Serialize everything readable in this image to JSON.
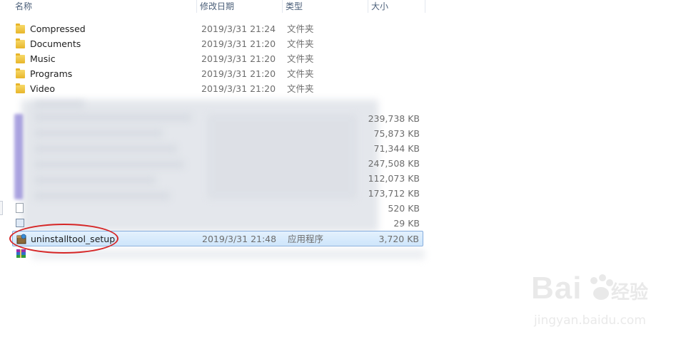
{
  "columns": {
    "name": "名称",
    "date": "修改日期",
    "type": "类型",
    "size": "大小"
  },
  "folders": [
    {
      "name": "Compressed",
      "date": "2019/3/31 21:24",
      "type": "文件夹"
    },
    {
      "name": "Documents",
      "date": "2019/3/31 21:20",
      "type": "文件夹"
    },
    {
      "name": "Music",
      "date": "2019/3/31 21:20",
      "type": "文件夹"
    },
    {
      "name": "Programs",
      "date": "2019/3/31 21:20",
      "type": "文件夹"
    },
    {
      "name": "Video",
      "date": "2019/3/31 21:20",
      "type": "文件夹"
    }
  ],
  "blurred_sizes": [
    "239,738 KB",
    "75,873 KB",
    "71,344 KB",
    "247,508 KB",
    "112,073 KB",
    "173,712 KB",
    "520 KB",
    "29 KB"
  ],
  "selected_file": {
    "name": "uninstalltool_setup",
    "date": "2019/3/31 21:48",
    "type": "应用程序",
    "size": "3,720 KB"
  },
  "watermark": {
    "brand": "Bai",
    "cn": "经验",
    "url": "jingyan.baidu.com"
  }
}
